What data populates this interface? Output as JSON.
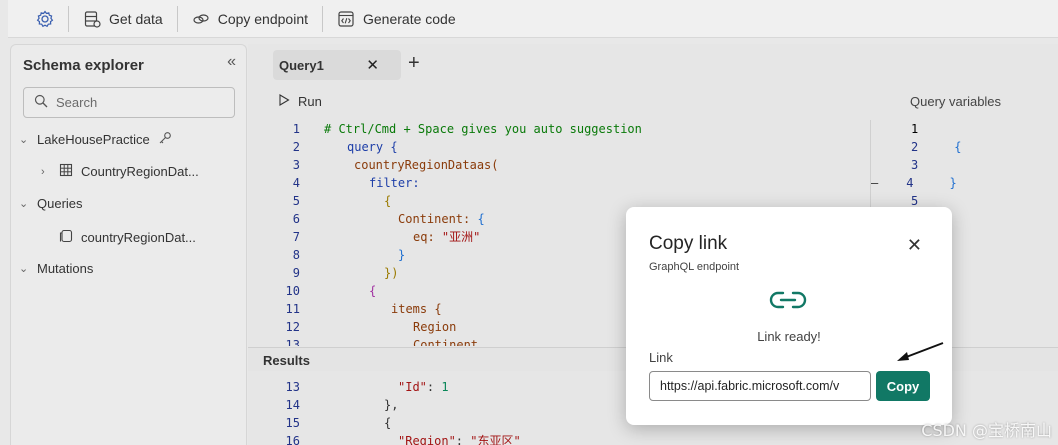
{
  "toolbar": {
    "settings_icon": "gear-icon",
    "get_data": "Get data",
    "copy_endpoint": "Copy endpoint",
    "generate_code": "Generate code"
  },
  "sidebar": {
    "title": "Schema explorer",
    "collapse": "«",
    "search_placeholder": "Search",
    "lakehouse": "LakeHousePractice",
    "table_item": "CountryRegionDat...",
    "queries": "Queries",
    "query_item": "countryRegionDat...",
    "mutations": "Mutations"
  },
  "editor": {
    "tab_label": "Query1",
    "tab_close": "✕",
    "tab_add": "+",
    "run_label": "Run",
    "query_variables_label": "Query variables",
    "code_lines": [
      {
        "n": "1",
        "text": "# Ctrl/Cmd + Space gives you auto suggestion"
      },
      {
        "n": "2",
        "text": "query {"
      },
      {
        "n": "3",
        "text": "countryRegionDataas("
      },
      {
        "n": "4",
        "text": "filter:"
      },
      {
        "n": "5",
        "text": "{"
      },
      {
        "n": "6",
        "text": "Continent:"
      },
      {
        "n": "7",
        "text": "eq:"
      },
      {
        "n": "8",
        "text": "}"
      },
      {
        "n": "9",
        "text": "})"
      },
      {
        "n": "10",
        "text": "{"
      },
      {
        "n": "11",
        "text": "items {"
      },
      {
        "n": "12",
        "text": "Region"
      },
      {
        "n": "13",
        "text": "Continent"
      }
    ],
    "continent_open": "{",
    "eq_value": "\"亚洲\"",
    "variables_lines": [
      {
        "n": "1",
        "text": ""
      },
      {
        "n": "2",
        "text": "{"
      },
      {
        "n": "3",
        "text": ""
      },
      {
        "n": "4",
        "text": "}"
      },
      {
        "n": "5",
        "text": ""
      }
    ],
    "fold_marker": "—"
  },
  "results": {
    "label": "Results",
    "lines": [
      {
        "n": "13",
        "key": "\"Id\"",
        "sep": ": ",
        "val": "1"
      },
      {
        "n": "14",
        "key": "",
        "sep": "},",
        "val": ""
      },
      {
        "n": "15",
        "key": "",
        "sep": "{",
        "val": ""
      },
      {
        "n": "16",
        "key": "\"Region\"",
        "sep": ": ",
        "val": "\"东亚区\""
      }
    ]
  },
  "modal": {
    "title": "Copy link",
    "subtitle": "GraphQL endpoint",
    "close_icon": "✕",
    "link_icon": "link-icon",
    "status": "Link ready!",
    "link_label": "Link",
    "link_value": "https://api.fabric.microsoft.com/v",
    "copy_button": "Copy"
  },
  "watermark": "CSDN @宝桥南山",
  "colors": {
    "accent": "#117865",
    "background": "#e8e8e8"
  }
}
